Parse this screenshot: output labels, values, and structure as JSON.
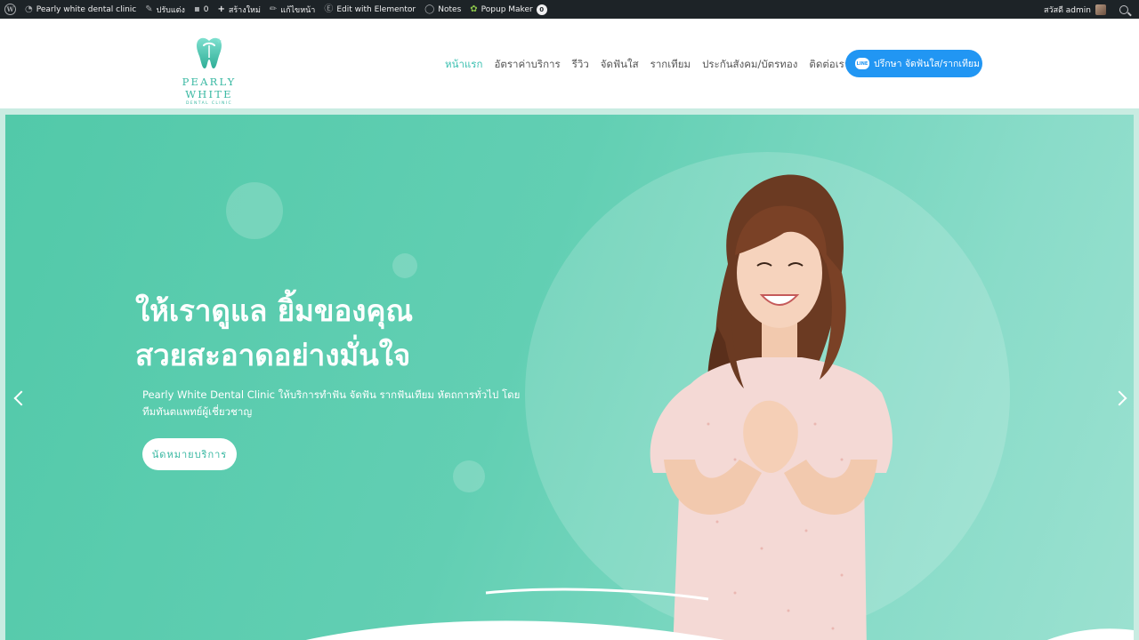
{
  "adminbar": {
    "site_name": "Pearly white dental clinic",
    "customize": "ปรับแต่ง",
    "comments_count": "0",
    "new": "สร้างใหม่",
    "edit_page": "แก้ไขหน้า",
    "elementor": "Edit with Elementor",
    "notes": "Notes",
    "popup_maker": "Popup Maker",
    "popup_count": "0",
    "greeting": "สวัสดี admin"
  },
  "header": {
    "logo_name": "PEARLY WHITE",
    "logo_sub": "DENTAL CLINIC",
    "nav": [
      "หน้าแรก",
      "อัตราค่าบริการ",
      "รีวิว",
      "จัดฟันใส",
      "รากเทียม",
      "ประกันสังคม/บัตรทอง",
      "ติดต่อเรา"
    ],
    "cta_icon_text": "LINE",
    "cta_label": "ปรึกษา จัดฟันใส/รากเทียม"
  },
  "hero": {
    "headline_line1": "ให้เราดูแล ยิ้มของคุณ",
    "headline_line2": "สวยสะอาดอย่างมั่นใจ",
    "subline": "Pearly White Dental Clinic ให้บริการทำฟัน จัดฟัน รากฟันเทียม หัตถการทั่วไป โดยทีมทันตแพทย์ผู้เชี่ยวชาญ",
    "button": "นัดหมายบริการ"
  },
  "colors": {
    "accent": "#3ec1b2",
    "cta_blue": "#2196f3",
    "hero_green": "#5ccdae",
    "adminbar": "#1d2327"
  }
}
